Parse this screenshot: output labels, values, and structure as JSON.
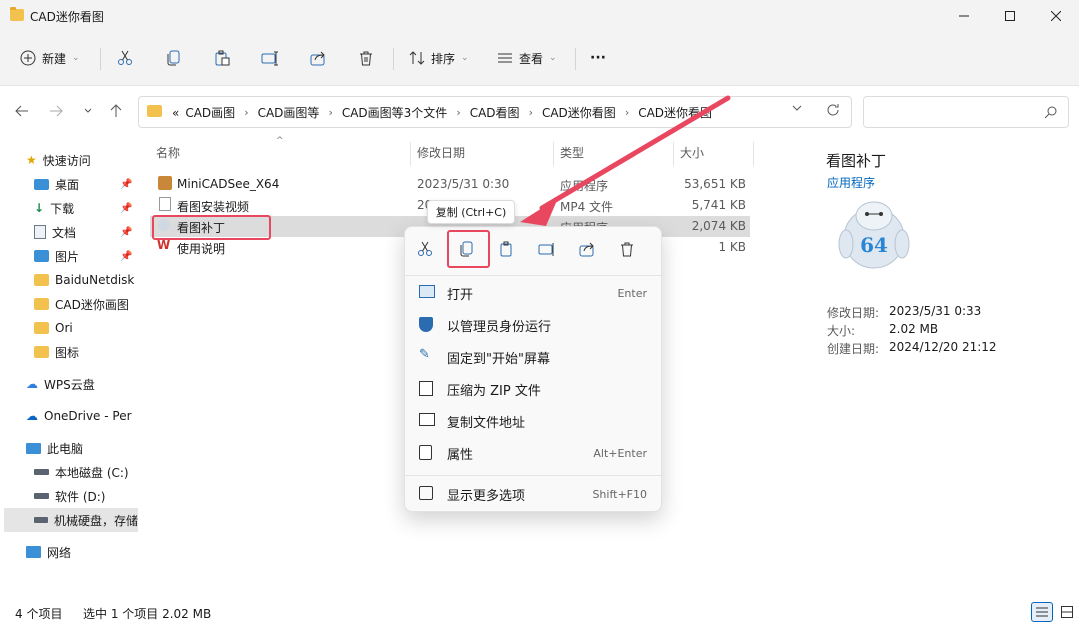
{
  "window": {
    "title": "CAD迷你看图"
  },
  "toolbar": {
    "new_label": "新建",
    "sort_label": "排序",
    "view_label": "查看",
    "more_label": "···"
  },
  "address": {
    "overflow": "«",
    "crumbs": [
      "CAD画图",
      "CAD画图等",
      "CAD画图等3个文件",
      "CAD看图",
      "CAD迷你看图",
      "CAD迷你看图"
    ]
  },
  "sidebar": {
    "items": [
      {
        "label": "快速访问",
        "icon": "star-icon"
      },
      {
        "label": "桌面",
        "icon": "desktop-icon",
        "pinned": true
      },
      {
        "label": "下载",
        "icon": "download-icon",
        "pinned": true
      },
      {
        "label": "文档",
        "icon": "document-icon",
        "pinned": true
      },
      {
        "label": "图片",
        "icon": "picture-icon",
        "pinned": true
      },
      {
        "label": "BaiduNetdisk",
        "icon": "folder-icon"
      },
      {
        "label": "CAD迷你画图",
        "icon": "folder-icon"
      },
      {
        "label": "Ori",
        "icon": "folder-icon"
      },
      {
        "label": "图标",
        "icon": "folder-icon"
      },
      {
        "label": "WPS云盘",
        "icon": "cloud-icon"
      },
      {
        "label": "OneDrive - Per",
        "icon": "onedrive-icon"
      },
      {
        "label": "此电脑",
        "icon": "computer-icon"
      },
      {
        "label": "本地磁盘 (C:)",
        "icon": "drive-icon"
      },
      {
        "label": "软件 (D:)",
        "icon": "drive-icon"
      },
      {
        "label": "机械硬盘，存储",
        "icon": "drive-icon"
      },
      {
        "label": "网络",
        "icon": "network-icon"
      }
    ]
  },
  "columns": {
    "name": "名称",
    "modified": "修改日期",
    "type": "类型",
    "size": "大小"
  },
  "files": [
    {
      "name": "MiniCADSee_X64",
      "modified": "2023/5/31 0:30",
      "type": "应用程序",
      "size": "53,651 KB"
    },
    {
      "name": "看图安装视频",
      "modified": "20",
      "type": "MP4 文件",
      "size": "5,741 KB"
    },
    {
      "name": "看图补丁",
      "modified": "",
      "type": "应用程序",
      "size": "2,074 KB"
    },
    {
      "name": "使用说明",
      "modified": "",
      "type": "",
      "size": "1 KB"
    }
  ],
  "tooltip": "复制 (Ctrl+C)",
  "context_menu": {
    "items": [
      {
        "label": "打开",
        "shortcut": "Enter"
      },
      {
        "label": "以管理员身份运行",
        "shortcut": ""
      },
      {
        "label": "固定到\"开始\"屏幕",
        "shortcut": ""
      },
      {
        "label": "压缩为 ZIP 文件",
        "shortcut": ""
      },
      {
        "label": "复制文件地址",
        "shortcut": ""
      },
      {
        "label": "属性",
        "shortcut": "Alt+Enter"
      },
      {
        "label": "显示更多选项",
        "shortcut": "Shift+F10"
      }
    ]
  },
  "details": {
    "name": "看图补丁",
    "type": "应用程序",
    "badge": "64",
    "modified_label": "修改日期:",
    "modified_value": "2023/5/31 0:33",
    "size_label": "大小:",
    "size_value": "2.02 MB",
    "created_label": "创建日期:",
    "created_value": "2024/12/20 21:12"
  },
  "status": {
    "count": "4 个项目",
    "selected": "选中 1 个项目  2.02 MB"
  },
  "colors": {
    "accent": "#0067c0",
    "highlight": "#e8475f",
    "folder": "#f2c14e"
  }
}
